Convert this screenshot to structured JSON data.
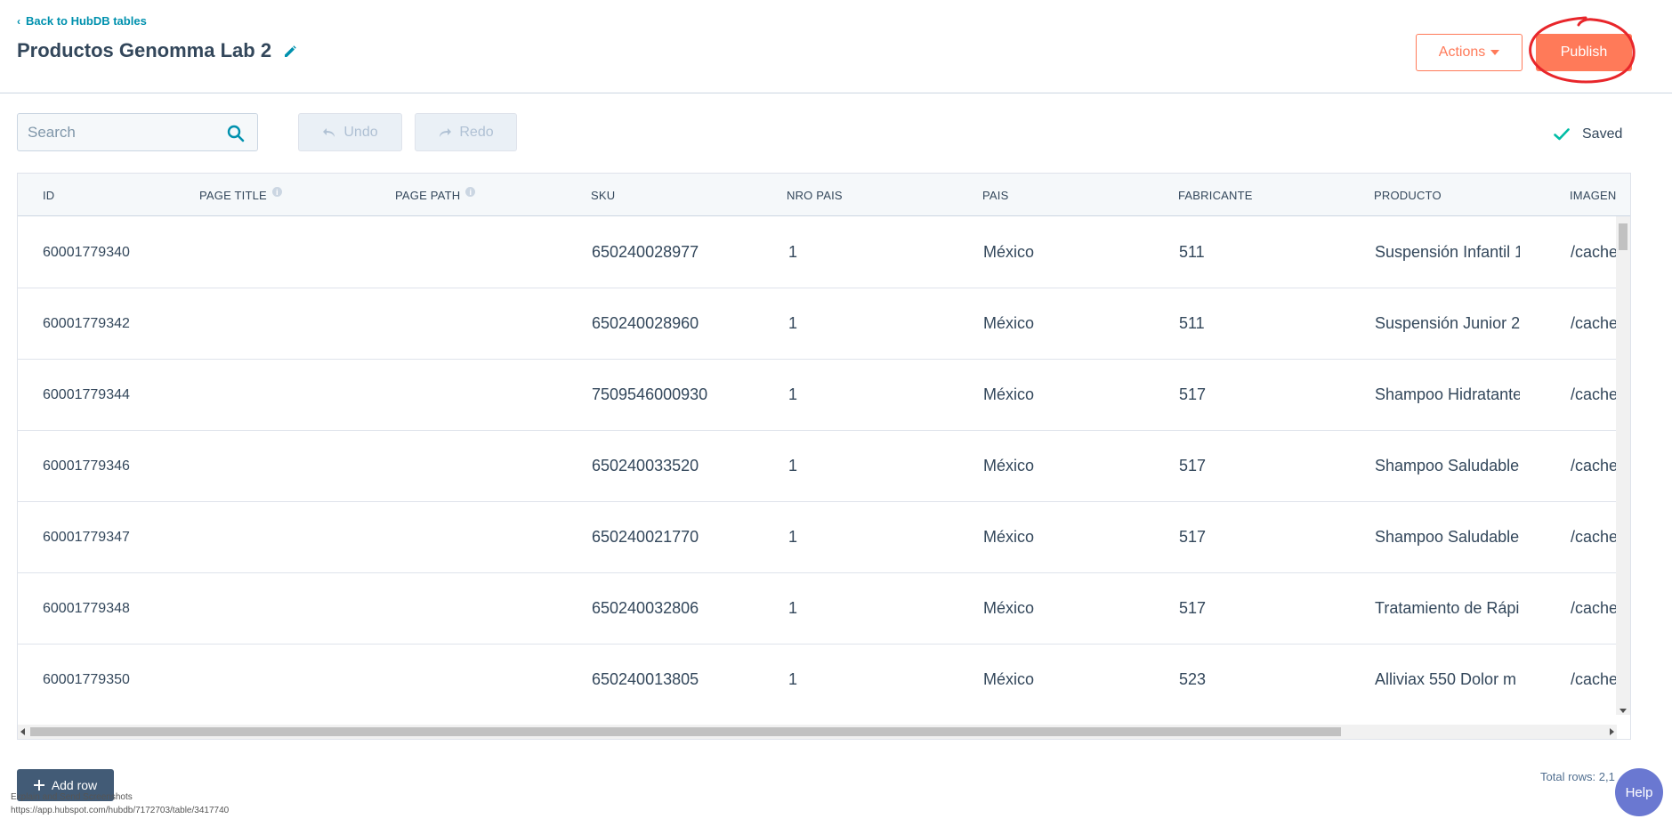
{
  "header": {
    "back_label": "Back to HubDB tables",
    "title": "Productos Genomma Lab 2",
    "actions_label": "Actions",
    "publish_label": "Publish"
  },
  "toolbar": {
    "search_placeholder": "Search",
    "undo_label": "Undo",
    "redo_label": "Redo",
    "saved_label": "Saved"
  },
  "table": {
    "columns": [
      "ID",
      "PAGE TITLE",
      "PAGE PATH",
      "SKU",
      "NRO PAIS",
      "PAIS",
      "FABRICANTE",
      "PRODUCTO",
      "IMAGEN"
    ],
    "rows": [
      {
        "id": "60001779340",
        "page_title": "",
        "page_path": "",
        "sku": "650240028977",
        "nro_pais": "1",
        "pais": "México",
        "fabricante": "511",
        "producto": "Suspensión Infantil 1",
        "imagen": "/cache"
      },
      {
        "id": "60001779342",
        "page_title": "",
        "page_path": "",
        "sku": "650240028960",
        "nro_pais": "1",
        "pais": "México",
        "fabricante": "511",
        "producto": "Suspensión Junior 2",
        "imagen": "/cache"
      },
      {
        "id": "60001779344",
        "page_title": "",
        "page_path": "",
        "sku": "7509546000930",
        "nro_pais": "1",
        "pais": "México",
        "fabricante": "517",
        "producto": "Shampoo Hidratante",
        "imagen": "/cache"
      },
      {
        "id": "60001779346",
        "page_title": "",
        "page_path": "",
        "sku": "650240033520",
        "nro_pais": "1",
        "pais": "México",
        "fabricante": "517",
        "producto": "Shampoo Saludable",
        "imagen": "/cache"
      },
      {
        "id": "60001779347",
        "page_title": "",
        "page_path": "",
        "sku": "650240021770",
        "nro_pais": "1",
        "pais": "México",
        "fabricante": "517",
        "producto": "Shampoo Saludable",
        "imagen": "/cache"
      },
      {
        "id": "60001779348",
        "page_title": "",
        "page_path": "",
        "sku": "650240032806",
        "nro_pais": "1",
        "pais": "México",
        "fabricante": "517",
        "producto": "Tratamiento de Rápi",
        "imagen": "/cache"
      },
      {
        "id": "60001779350",
        "page_title": "",
        "page_path": "",
        "sku": "650240013805",
        "nro_pais": "1",
        "pais": "México",
        "fabricante": "523",
        "producto": "Alliviax 550 Dolor m",
        "imagen": "/cache"
      }
    ]
  },
  "footer": {
    "add_row_label": "Add row",
    "total_rows_label": "Total rows: 2,1",
    "help_label": "Help",
    "overlay_title": "Explain and Send Screenshots",
    "overlay_url": "https://app.hubspot.com/hubdb/7172703/table/3417740"
  },
  "colors": {
    "accent": "#ff7a59",
    "link": "#0091ae",
    "text": "#33475b",
    "success": "#00bda5",
    "help": "#6a78d1",
    "annotation": "#e8262b"
  },
  "icons": [
    "chevron-left-icon",
    "pencil-icon",
    "caret-down-icon",
    "search-icon",
    "undo-icon",
    "redo-icon",
    "check-icon",
    "info-icon",
    "plus-icon"
  ]
}
